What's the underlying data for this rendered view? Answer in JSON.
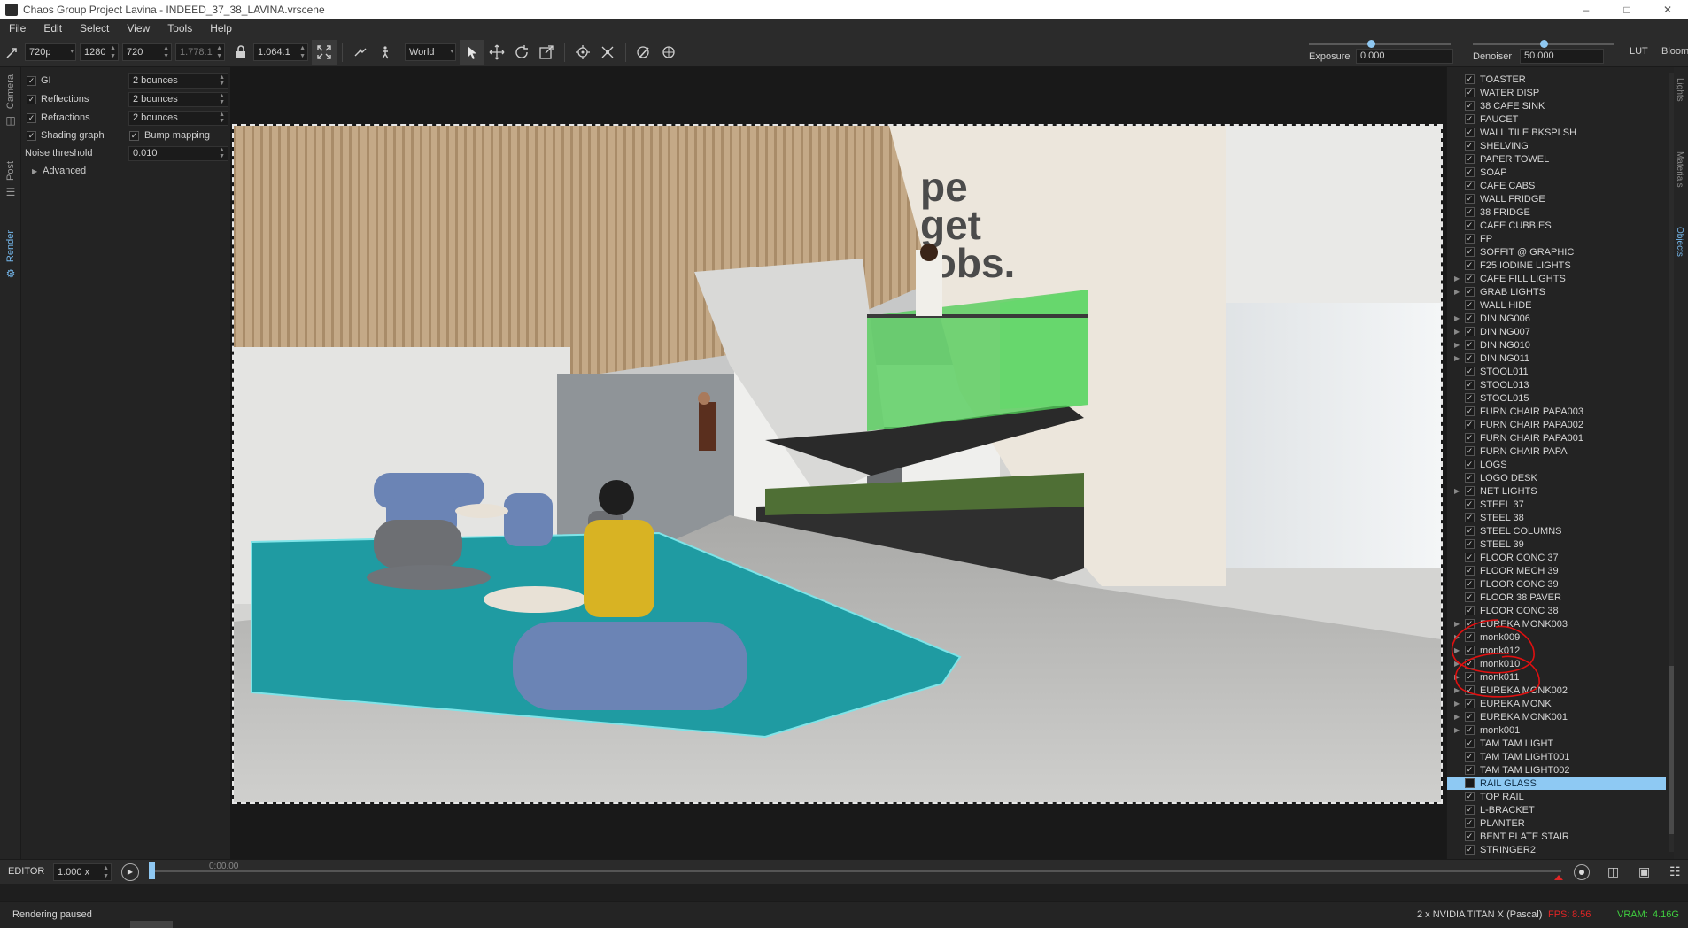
{
  "window": {
    "title": "Chaos Group Project Lavina - INDEED_37_38_LAVINA.vrscene"
  },
  "menu": [
    "File",
    "Edit",
    "Select",
    "View",
    "Tools",
    "Help"
  ],
  "toolbar": {
    "resolution_preset": "720p",
    "width": "1280",
    "height": "720",
    "aspect": "1.778:1",
    "pixel_aspect": "1.064:1",
    "coord_space": "World",
    "exposure_label": "Exposure",
    "exposure_value": "0.000",
    "exposure_level": 0.44,
    "denoiser_label": "Denoiser",
    "denoiser_value": "50.000",
    "denoiser_level": 0.5,
    "lut_label": "LUT",
    "bloom_label": "Bloom"
  },
  "left_tabs": [
    "Camera",
    "Post",
    "Render"
  ],
  "settings": {
    "gi_label": "GI",
    "gi_value": "2 bounces",
    "reflections_label": "Reflections",
    "reflections_value": "2 bounces",
    "refractions_label": "Refractions",
    "refractions_value": "2 bounces",
    "shading_label": "Shading graph",
    "bump_label": "Bump mapping",
    "noise_label": "Noise threshold",
    "noise_value": "0.010",
    "advanced_label": "Advanced"
  },
  "scene_text": [
    "pe",
    "get",
    "jobs."
  ],
  "outliner": [
    {
      "name": "TOASTER",
      "checked": true,
      "expand": false
    },
    {
      "name": "WATER DISP",
      "checked": true,
      "expand": false
    },
    {
      "name": "38 CAFE SINK",
      "checked": true,
      "expand": false
    },
    {
      "name": "FAUCET",
      "checked": true,
      "expand": false
    },
    {
      "name": "WALL TILE BKSPLSH",
      "checked": true,
      "expand": false
    },
    {
      "name": "SHELVING",
      "checked": true,
      "expand": false
    },
    {
      "name": "PAPER TOWEL",
      "checked": true,
      "expand": false
    },
    {
      "name": "SOAP",
      "checked": true,
      "expand": false
    },
    {
      "name": "CAFE CABS",
      "checked": true,
      "expand": false
    },
    {
      "name": "WALL FRIDGE",
      "checked": true,
      "expand": false
    },
    {
      "name": "38 FRIDGE",
      "checked": true,
      "expand": false
    },
    {
      "name": "CAFE CUBBIES",
      "checked": true,
      "expand": false
    },
    {
      "name": "FP",
      "checked": true,
      "expand": false
    },
    {
      "name": "SOFFIT @ GRAPHIC",
      "checked": true,
      "expand": false
    },
    {
      "name": "F25 IODINE LIGHTS",
      "checked": true,
      "expand": false
    },
    {
      "name": "CAFE FILL LIGHTS",
      "checked": true,
      "expand": true
    },
    {
      "name": "GRAB LIGHTS",
      "checked": true,
      "expand": true
    },
    {
      "name": "WALL HIDE",
      "checked": true,
      "expand": false
    },
    {
      "name": "DINING006",
      "checked": true,
      "expand": true
    },
    {
      "name": "DINING007",
      "checked": true,
      "expand": true
    },
    {
      "name": "DINING010",
      "checked": true,
      "expand": true
    },
    {
      "name": "DINING011",
      "checked": true,
      "expand": true
    },
    {
      "name": "STOOL011",
      "checked": true,
      "expand": false
    },
    {
      "name": "STOOL013",
      "checked": true,
      "expand": false
    },
    {
      "name": "STOOL015",
      "checked": true,
      "expand": false
    },
    {
      "name": "FURN CHAIR PAPA003",
      "checked": true,
      "expand": false
    },
    {
      "name": "FURN CHAIR PAPA002",
      "checked": true,
      "expand": false
    },
    {
      "name": "FURN CHAIR PAPA001",
      "checked": true,
      "expand": false
    },
    {
      "name": "FURN CHAIR PAPA",
      "checked": true,
      "expand": false
    },
    {
      "name": "LOGS",
      "checked": true,
      "expand": false
    },
    {
      "name": "LOGO DESK",
      "checked": true,
      "expand": false
    },
    {
      "name": "NET LIGHTS",
      "checked": true,
      "expand": true
    },
    {
      "name": "STEEL 37",
      "checked": true,
      "expand": false
    },
    {
      "name": "STEEL 38",
      "checked": true,
      "expand": false
    },
    {
      "name": "STEEL COLUMNS",
      "checked": true,
      "expand": false
    },
    {
      "name": "STEEL 39",
      "checked": true,
      "expand": false
    },
    {
      "name": "FLOOR CONC 37",
      "checked": true,
      "expand": false
    },
    {
      "name": "FLOOR MECH 39",
      "checked": true,
      "expand": false
    },
    {
      "name": "FLOOR CONC 39",
      "checked": true,
      "expand": false
    },
    {
      "name": "FLOOR 38 PAVER",
      "checked": true,
      "expand": false
    },
    {
      "name": "FLOOR CONC 38",
      "checked": true,
      "expand": false
    },
    {
      "name": "EUREKA MONK003",
      "checked": true,
      "expand": true
    },
    {
      "name": "monk009",
      "checked": true,
      "expand": true
    },
    {
      "name": "monk012",
      "checked": true,
      "expand": true
    },
    {
      "name": "monk010",
      "checked": true,
      "expand": true
    },
    {
      "name": "monk011",
      "checked": true,
      "expand": true
    },
    {
      "name": "EUREKA MONK002",
      "checked": true,
      "expand": true
    },
    {
      "name": "EUREKA MONK",
      "checked": true,
      "expand": true
    },
    {
      "name": "EUREKA MONK001",
      "checked": true,
      "expand": true
    },
    {
      "name": "monk001",
      "checked": true,
      "expand": true
    },
    {
      "name": "TAM TAM LIGHT",
      "checked": true,
      "expand": false
    },
    {
      "name": "TAM TAM LIGHT001",
      "checked": true,
      "expand": false
    },
    {
      "name": "TAM TAM LIGHT002",
      "checked": true,
      "expand": false
    },
    {
      "name": "RAIL GLASS",
      "checked": false,
      "expand": false,
      "selected": true
    },
    {
      "name": "TOP RAIL",
      "checked": true,
      "expand": false
    },
    {
      "name": "L-BRACKET",
      "checked": true,
      "expand": false
    },
    {
      "name": "PLANTER",
      "checked": true,
      "expand": false
    },
    {
      "name": "BENT PLATE STAIR",
      "checked": true,
      "expand": false
    },
    {
      "name": "STRINGER2",
      "checked": true,
      "expand": false
    }
  ],
  "right_tabs": [
    "Lights",
    "Materials",
    "Objects"
  ],
  "timeline": {
    "mode": "EDITOR",
    "speed": "1.000 x",
    "time": "0:00.00"
  },
  "status": {
    "message": "Rendering paused",
    "gpu": "2 x NVIDIA TITAN X (Pascal)",
    "fps_label": "FPS:",
    "fps": "8.56",
    "vram_label": "VRAM:",
    "vram": "4.16G",
    "accent": "#e02525",
    "vram_color": "#3fcf3f"
  },
  "colors": {
    "selection": "#8ec9f3",
    "slider": "#8fc8f2",
    "annotation": "#e01010"
  }
}
